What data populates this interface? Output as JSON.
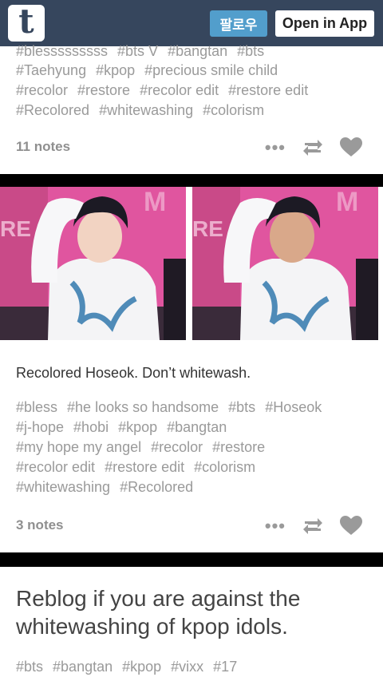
{
  "header": {
    "logo_letter": "t",
    "follow_label": "팔로우",
    "open_app_label": "Open in App"
  },
  "post1": {
    "tags_top_partial": [
      "#blesssssssss",
      "#bts V",
      "#bangtan",
      "#bts"
    ],
    "tags": [
      "#Taehyung",
      "#kpop",
      "#precious smile child",
      "#recolor",
      "#restore",
      "#recolor edit",
      "#restore edit",
      "#Recolored",
      "#whitewashing",
      "#colorism"
    ],
    "notes": "11 notes"
  },
  "post2": {
    "caption": "Recolored Hoseok. Don’t whitewash.",
    "tags": [
      "#bless",
      "#he looks so handsome",
      "#bts",
      "#Hoseok",
      "#j-hope",
      "#hobi",
      "#kpop",
      "#bangtan",
      "#my hope my angel",
      "#recolor",
      "#restore",
      "#recolor edit",
      "#restore edit",
      "#colorism",
      "#whitewashing",
      "#Recolored"
    ],
    "notes": "3 notes",
    "photos": [
      "original-photo",
      "recolored-photo"
    ]
  },
  "post3": {
    "title": "Reblog if you are against the whitewashing of kpop idols.",
    "tags": [
      "#bts",
      "#bangtan",
      "#kpop",
      "#vixx",
      "#17"
    ]
  },
  "colors": {
    "header_bg": "#36465d",
    "follow_btn": "#529ecc",
    "tag_text": "#9a9a9a",
    "photo_bg": "#e0559f"
  },
  "icons": [
    "more-dots-icon",
    "reblog-icon",
    "heart-icon"
  ]
}
